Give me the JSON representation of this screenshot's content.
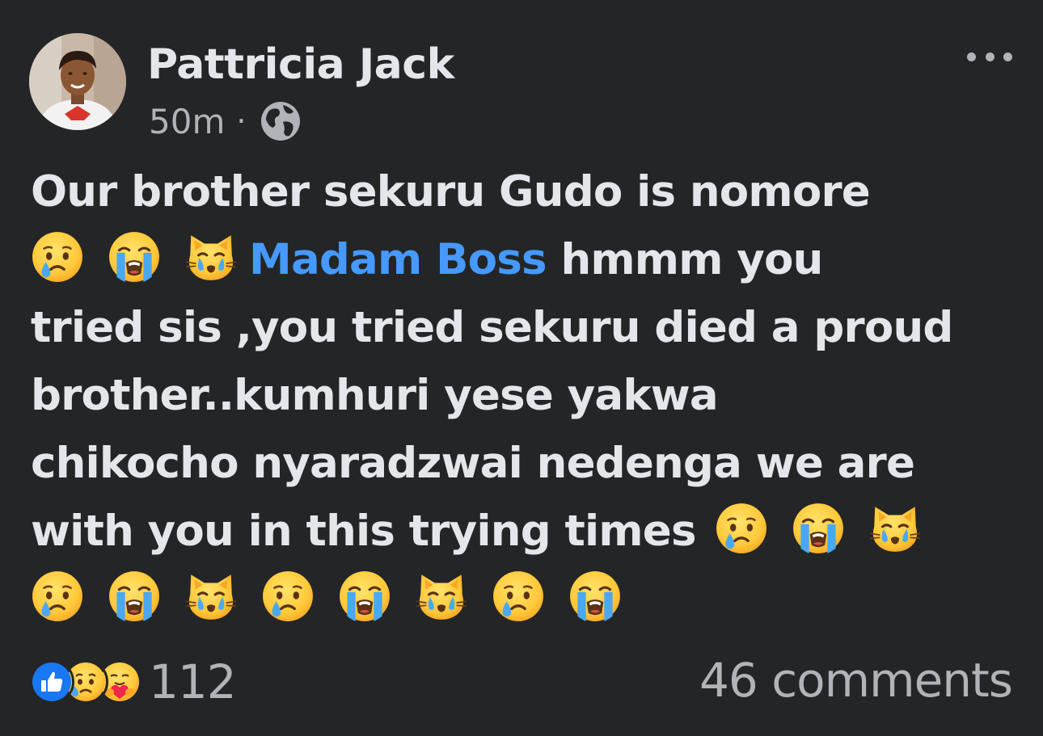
{
  "post": {
    "author": "Pattricia Jack",
    "time": "50m",
    "separator": "·",
    "privacy_icon": "globe-icon",
    "text_lines": [
      "Our brother sekuru Gudo is nomore",
      "tried sis ,you tried sekuru died a proud",
      "brother..kumhuri yese yakwa",
      "chikocho nyaradzwai nedenga we are"
    ],
    "line2_mention": "Madam Boss",
    "line2_after": " hmmm you",
    "line7_text": "with you in this trying times",
    "emojis": {
      "sad": "crying-face-emoji",
      "sob": "loudly-crying-face-emoji",
      "cat": "crying-cat-emoji"
    }
  },
  "footer": {
    "reaction_icons": [
      "like-reaction-icon",
      "sad-reaction-icon",
      "care-reaction-icon"
    ],
    "reaction_count": "112",
    "comments": "46 comments"
  },
  "colors": {
    "background": "#242526",
    "text": "#e4e6eb",
    "secondary": "#b0b3b8",
    "mention": "#4599ff",
    "like_blue": "#1877f2"
  }
}
